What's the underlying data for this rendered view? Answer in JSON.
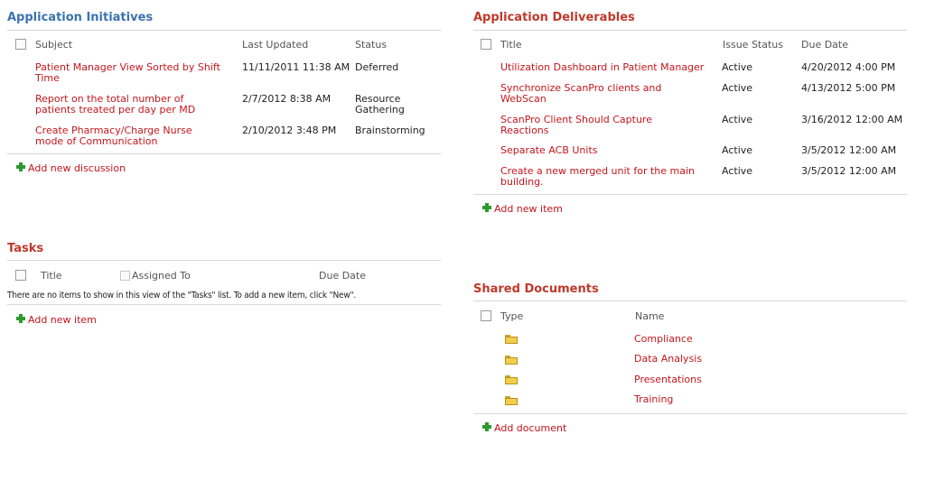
{
  "initiatives": {
    "title": "Application Initiatives",
    "headers": {
      "subject": "Subject",
      "last_updated": "Last Updated",
      "status": "Status"
    },
    "rows": [
      {
        "subject": "Patient Manager View Sorted by Shift Time",
        "last_updated": "11/11/2011 11:38 AM",
        "status": "Deferred"
      },
      {
        "subject": "Report on the total number of patients treated per day per MD",
        "last_updated": "2/7/2012 8:38 AM",
        "status": "Resource Gathering"
      },
      {
        "subject": "Create Pharmacy/Charge Nurse mode of Communication",
        "last_updated": "2/10/2012 3:48 PM",
        "status": "Brainstorming"
      }
    ],
    "add_label": "Add new discussion"
  },
  "deliverables": {
    "title": "Application Deliverables",
    "headers": {
      "title": "Title",
      "issue_status": "Issue Status",
      "due_date": "Due Date"
    },
    "rows": [
      {
        "title": "Utilization Dashboard in Patient Manager",
        "issue_status": "Active",
        "due_date": "4/20/2012 4:00 PM"
      },
      {
        "title": "Synchronize ScanPro clients and WebScan",
        "issue_status": "Active",
        "due_date": "4/13/2012 5:00 PM"
      },
      {
        "title": "ScanPro Client Should Capture Reactions",
        "issue_status": "Active",
        "due_date": "3/16/2012 12:00 AM"
      },
      {
        "title": "Separate ACB Units",
        "issue_status": "Active",
        "due_date": "3/5/2012 12:00 AM"
      },
      {
        "title": "Create a new merged unit for the main building.",
        "issue_status": "Active",
        "due_date": "3/5/2012 12:00 AM"
      }
    ],
    "add_label": "Add new item"
  },
  "tasks": {
    "title": "Tasks",
    "headers": {
      "title": "Title",
      "assigned_to": "Assigned To",
      "due_date": "Due Date"
    },
    "empty_message": "There are no items to show in this view of the \"Tasks\" list. To add a new item, click \"New\".",
    "add_label": "Add new item"
  },
  "documents": {
    "title": "Shared Documents",
    "headers": {
      "type": "Type",
      "name": "Name"
    },
    "rows": [
      {
        "type_icon": "folder-icon",
        "name": "Compliance"
      },
      {
        "type_icon": "folder-icon",
        "name": "Data Analysis"
      },
      {
        "type_icon": "folder-icon",
        "name": "Presentations"
      },
      {
        "type_icon": "folder-icon",
        "name": "Training"
      }
    ],
    "add_label": "Add document"
  },
  "colors": {
    "title_blue": "#3b73af",
    "title_red": "#c0392b",
    "link_red": "#c4161c",
    "add_green": "#2e9a2e"
  }
}
